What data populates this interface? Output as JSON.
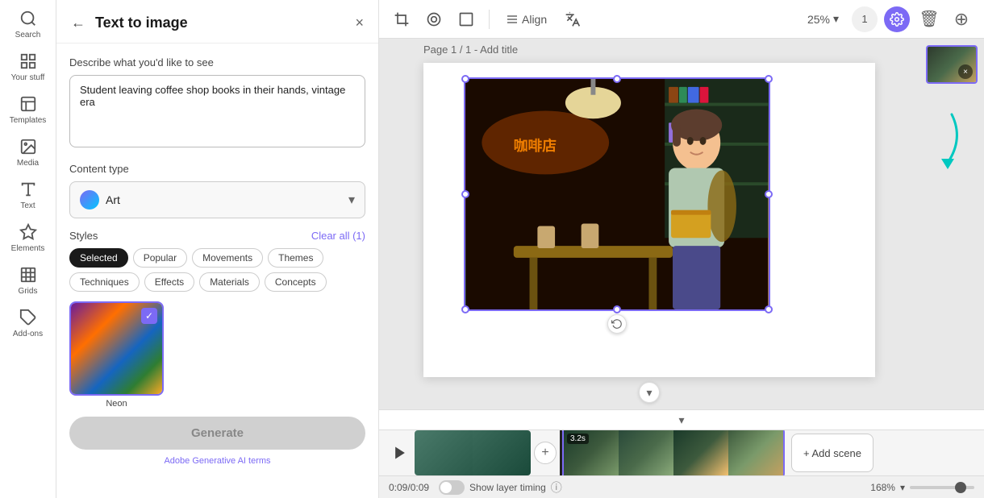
{
  "sidebar": {
    "items": [
      {
        "label": "Search",
        "icon": "search-icon"
      },
      {
        "label": "Your stuff",
        "icon": "grid-icon"
      },
      {
        "label": "Templates",
        "icon": "template-icon"
      },
      {
        "label": "Media",
        "icon": "media-icon"
      },
      {
        "label": "Text",
        "icon": "text-icon"
      },
      {
        "label": "Elements",
        "icon": "elements-icon"
      },
      {
        "label": "Grids",
        "icon": "grids-icon"
      },
      {
        "label": "Add-ons",
        "icon": "addons-icon"
      }
    ]
  },
  "panel": {
    "back_label": "←",
    "title": "Text to image",
    "close_label": "×",
    "describe_label": "Describe what you'd like to see",
    "prompt_value": "Student leaving coffee shop books in their hands, vintage era",
    "content_type_label": "Content type",
    "content_type_value": "Art",
    "styles_label": "Styles",
    "clear_all_label": "Clear all (1)",
    "chips": [
      {
        "label": "Selected",
        "active": true
      },
      {
        "label": "Popular",
        "active": false
      },
      {
        "label": "Movements",
        "active": false
      },
      {
        "label": "Themes",
        "active": false
      },
      {
        "label": "Techniques",
        "active": false
      },
      {
        "label": "Effects",
        "active": false
      },
      {
        "label": "Materials",
        "active": false
      },
      {
        "label": "Concepts",
        "active": false
      }
    ],
    "style_cards": [
      {
        "name": "Neon",
        "selected": true
      }
    ],
    "generate_label": "Generate",
    "ai_terms_label": "Adobe Generative AI terms"
  },
  "toolbar": {
    "zoom_value": "25%",
    "page_number_label": "1",
    "align_label": "Align"
  },
  "canvas": {
    "page_label": "Page 1 / 1 - Add title"
  },
  "timeline": {
    "time_display": "0:09/0:09",
    "show_layer_timing_label": "Show layer timing",
    "zoom_level": "168%",
    "add_scene_label": "+ Add scene",
    "clip_duration": "3.2s",
    "expand_label": "▾"
  }
}
